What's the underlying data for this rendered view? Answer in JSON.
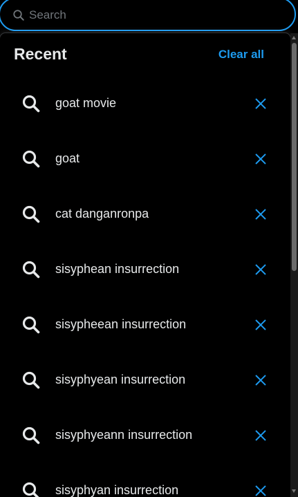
{
  "search": {
    "placeholder": "Search",
    "value": ""
  },
  "dropdown": {
    "title": "Recent",
    "clear_label": "Clear all",
    "items": [
      {
        "label": "goat movie"
      },
      {
        "label": "goat"
      },
      {
        "label": "cat danganronpa"
      },
      {
        "label": "sisyphean insurrection"
      },
      {
        "label": "sisypheean insurrection"
      },
      {
        "label": "sisyphyean insurrection"
      },
      {
        "label": "sisyphyeann insurrection"
      },
      {
        "label": "sisyphyan insurrection"
      }
    ]
  },
  "icons": {
    "search_bar": "search-icon",
    "item": "search-icon",
    "remove": "close-icon"
  },
  "colors": {
    "accent": "#1d9bf0",
    "background": "#000000",
    "text": "#e7e9ea",
    "placeholder": "#71767b"
  }
}
